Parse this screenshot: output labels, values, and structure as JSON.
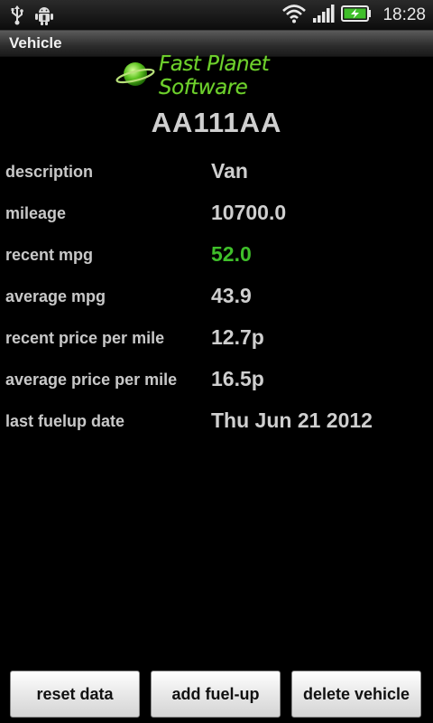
{
  "status_bar": {
    "time": "18:28",
    "icons": [
      "usb-icon",
      "android-debug-icon",
      "wifi-icon",
      "signal-icon",
      "battery-charging-icon"
    ]
  },
  "app_title": "Vehicle",
  "logo_text": "Fast Planet Software",
  "vehicle": {
    "registration": "AA111AA",
    "rows": [
      {
        "label": "description",
        "value": "Van"
      },
      {
        "label": "mileage",
        "value": "10700.0"
      },
      {
        "label": "recent mpg",
        "value": "52.0",
        "color": "#3fbf2a"
      },
      {
        "label": "average mpg",
        "value": "43.9"
      },
      {
        "label": "recent price per mile",
        "value": "12.7p"
      },
      {
        "label": "average price per mile",
        "value": "16.5p"
      },
      {
        "label": "last fuelup date",
        "value": "Thu Jun 21 2012"
      }
    ]
  },
  "buttons": {
    "reset": "reset data",
    "add_fuel": "add fuel-up",
    "delete": "delete vehicle"
  },
  "colors": {
    "accent_green": "#3fbf2a",
    "logo_green": "#6fd12d"
  }
}
